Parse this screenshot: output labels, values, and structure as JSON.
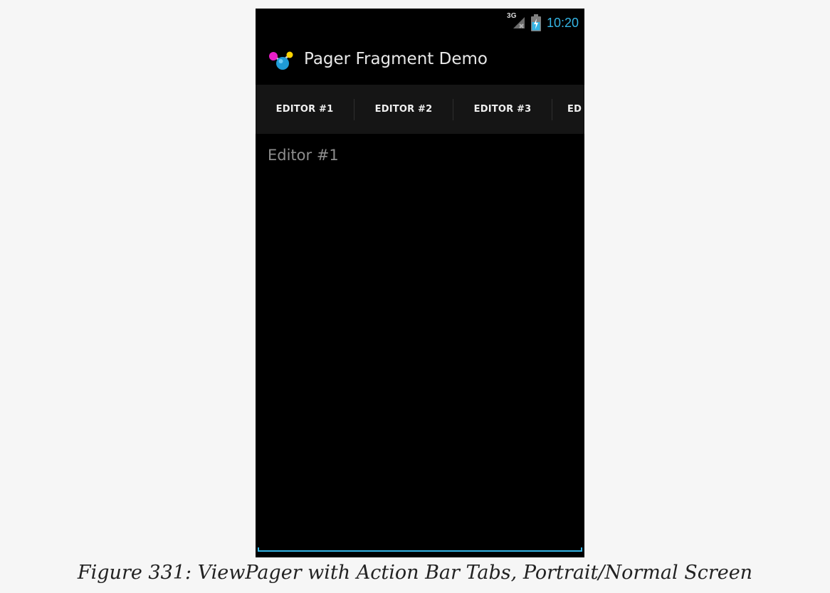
{
  "status_bar": {
    "network": "3G",
    "time": "10:20",
    "signal_icon": "signal-3g-icon",
    "battery_icon": "battery-charging-icon"
  },
  "action_bar": {
    "title": "Pager Fragment Demo",
    "app_icon": "molecule-app-icon"
  },
  "tabs": [
    {
      "label": "EDITOR #1",
      "selected": true
    },
    {
      "label": "EDITOR #2",
      "selected": false
    },
    {
      "label": "EDITOR #3",
      "selected": false
    },
    {
      "label": "ED",
      "selected": false
    }
  ],
  "content": {
    "editor_hint": "Editor #1"
  },
  "caption": "Figure 331: ViewPager with Action Bar Tabs, Portrait/Normal Screen",
  "colors": {
    "accent": "#35b5e5",
    "background": "#000000",
    "tab_bar": "#151515",
    "page_bg": "#f6f6f6"
  }
}
